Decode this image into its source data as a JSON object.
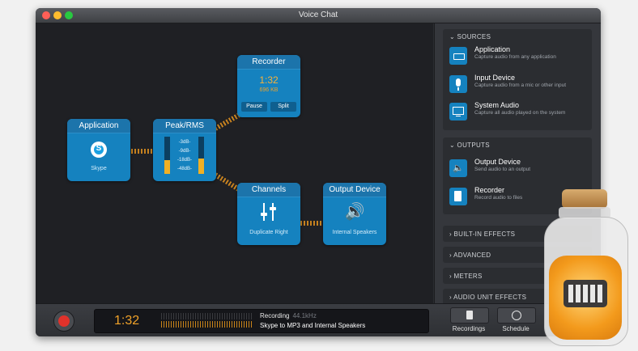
{
  "window": {
    "title": "Voice Chat"
  },
  "nodes": {
    "application": {
      "title": "Application",
      "subtitle": "Skype"
    },
    "peak": {
      "title": "Peak/RMS",
      "labels": [
        "-3dB-",
        "-9dB-",
        "-18dB-",
        "-48dB-"
      ]
    },
    "recorder": {
      "title": "Recorder",
      "time": "1:32",
      "size": "696 KB",
      "pause_label": "Pause",
      "split_label": "Split"
    },
    "channels": {
      "title": "Channels",
      "subtitle": "Duplicate Right"
    },
    "output": {
      "title": "Output Device",
      "subtitle": "Internal Speakers"
    }
  },
  "sidebar": {
    "sources": {
      "title": "SOURCES",
      "items": [
        {
          "name": "Application",
          "desc": "Capture audio from any application",
          "icon": "application-icon"
        },
        {
          "name": "Input Device",
          "desc": "Capture audio from a mic or other input",
          "icon": "microphone-icon"
        },
        {
          "name": "System Audio",
          "desc": "Capture all audio played on the system",
          "icon": "monitor-icon"
        }
      ]
    },
    "outputs": {
      "title": "OUTPUTS",
      "items": [
        {
          "name": "Output Device",
          "desc": "Send audio to an output",
          "icon": "speaker-icon"
        },
        {
          "name": "Recorder",
          "desc": "Record audio to files",
          "icon": "document-icon"
        }
      ]
    },
    "sections": [
      "BUILT-IN EFFECTS",
      "ADVANCED",
      "METERS",
      "AUDIO UNIT EFFECTS"
    ]
  },
  "bottom": {
    "time": "1:32",
    "status": "Recording",
    "rate": "44.1kHz",
    "detail": "Skype to MP3 and Internal Speakers",
    "recordings_label": "Recordings",
    "schedule_label": "Schedule"
  },
  "meter": {
    "left_level": 0.38,
    "right_level": 0.42
  },
  "colors": {
    "node": "#1582bf",
    "wire": "#c5811f",
    "accent": "#f0a229",
    "record": "#e0322b"
  }
}
